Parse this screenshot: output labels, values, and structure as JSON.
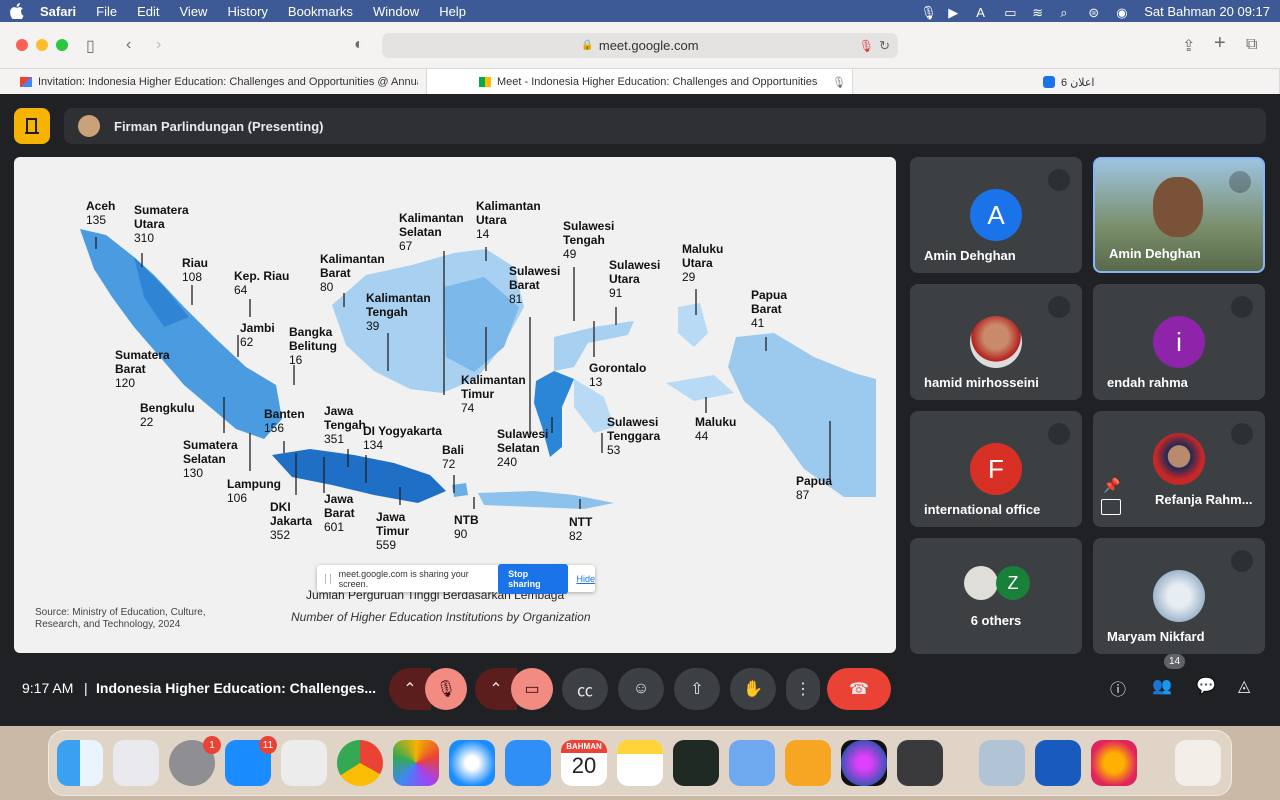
{
  "menubar": {
    "items": [
      "Safari",
      "File",
      "Edit",
      "View",
      "History",
      "Bookmarks",
      "Window",
      "Help"
    ],
    "datetime": "Sat Bahman 20  09:17"
  },
  "browser": {
    "url": "meet.google.com",
    "tabs": [
      {
        "label": "Invitation: Indonesia Higher Education: Challenges and Opportunities @ Annual..."
      },
      {
        "label": "Meet - Indonesia Higher Education: Challenges and Opportunities"
      },
      {
        "label": "6 اعلان"
      }
    ]
  },
  "meet": {
    "presenter": "Firman Parlindungan (Presenting)",
    "clock": "9:17 AM",
    "separator": "|",
    "meeting_title": "Indonesia Higher Education: Challenges...",
    "participants_count": "14",
    "share_banner": {
      "text": "meet.google.com is sharing your screen.",
      "stop": "Stop sharing",
      "hide": "Hide"
    },
    "slide": {
      "source": "Source: Ministry of Education, Culture, Research, and Technology, 2024",
      "caption_id": "Jumlah Perguruan Tinggi Berdasarkan Lembaga",
      "caption_en": "Number of Higher Education Institutions by Organization",
      "regions": [
        {
          "name": "Aceh",
          "value": "135"
        },
        {
          "name": "Sumatera Utara",
          "value": "310"
        },
        {
          "name": "Riau",
          "value": "108"
        },
        {
          "name": "Kep. Riau",
          "value": "64"
        },
        {
          "name": "Jambi",
          "value": "62"
        },
        {
          "name": "Sumatera Barat",
          "value": "120"
        },
        {
          "name": "Bengkulu",
          "value": "22"
        },
        {
          "name": "Sumatera Selatan",
          "value": "130"
        },
        {
          "name": "Lampung",
          "value": "106"
        },
        {
          "name": "Bangka Belitung",
          "value": "16"
        },
        {
          "name": "Banten",
          "value": "156"
        },
        {
          "name": "DKI Jakarta",
          "value": "352"
        },
        {
          "name": "Jawa Barat",
          "value": "601"
        },
        {
          "name": "Jawa Tengah",
          "value": "351"
        },
        {
          "name": "DI Yogyakarta",
          "value": "134"
        },
        {
          "name": "Jawa Timur",
          "value": "559"
        },
        {
          "name": "Bali",
          "value": "72"
        },
        {
          "name": "NTB",
          "value": "90"
        },
        {
          "name": "NTT",
          "value": "82"
        },
        {
          "name": "Kalimantan Barat",
          "value": "80"
        },
        {
          "name": "Kalimantan Tengah",
          "value": "39"
        },
        {
          "name": "Kalimantan Selatan",
          "value": "67"
        },
        {
          "name": "Kalimantan Utara",
          "value": "14"
        },
        {
          "name": "Kalimantan Timur",
          "value": "74"
        },
        {
          "name": "Sulawesi Barat",
          "value": "81"
        },
        {
          "name": "Sulawesi Tengah",
          "value": "49"
        },
        {
          "name": "Sulawesi Utara",
          "value": "91"
        },
        {
          "name": "Gorontalo",
          "value": "13"
        },
        {
          "name": "Sulawesi Selatan",
          "value": "240"
        },
        {
          "name": "Sulawesi Tenggara",
          "value": "53"
        },
        {
          "name": "Maluku Utara",
          "value": "29"
        },
        {
          "name": "Maluku",
          "value": "44"
        },
        {
          "name": "Papua Barat",
          "value": "41"
        },
        {
          "name": "Papua",
          "value": "87"
        }
      ]
    },
    "tiles": [
      {
        "name": "Amin Dehghan",
        "letter": "A",
        "color": "#1a73e8"
      },
      {
        "name": "Amin Dehghan"
      },
      {
        "name": "hamid mirhosseini"
      },
      {
        "name": "endah rahma",
        "letter": "i",
        "color": "#8e24aa"
      },
      {
        "name": "international office",
        "letter": "F",
        "color": "#d93025"
      },
      {
        "name": "Refanja Rahm..."
      },
      {
        "name": "6 others",
        "letter2": "Z"
      },
      {
        "name": "Maryam Nikfard"
      }
    ]
  },
  "dock": {
    "calendar_month": "BAHMAN",
    "calendar_day": "20",
    "settings_badge": "1",
    "appstore_badge": "11"
  }
}
